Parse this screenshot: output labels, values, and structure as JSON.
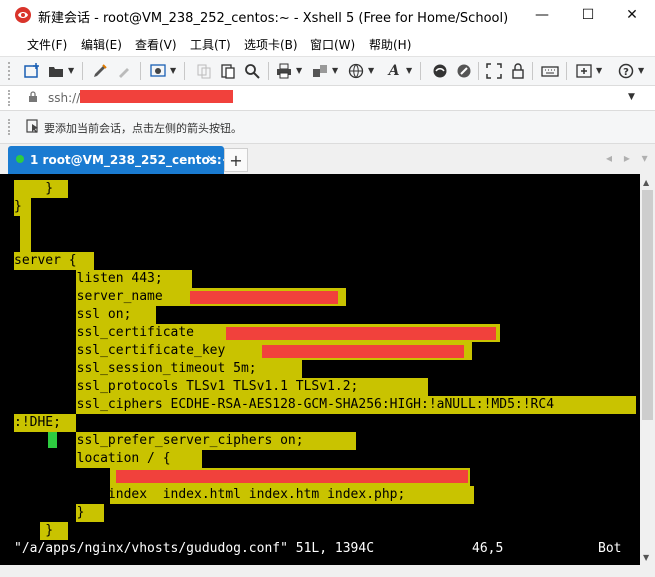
{
  "window": {
    "title": "新建会话 - root@VM_238_252_centos:~ - Xshell 5 (Free for Home/School)",
    "minimize": "—",
    "maximize": "☐",
    "close": "✕"
  },
  "menu": [
    "文件(F)",
    "编辑(E)",
    "查看(V)",
    "工具(T)",
    "选项卡(B)",
    "窗口(W)",
    "帮助(H)"
  ],
  "toolbar_icons": [
    "new-session-icon",
    "open-folder-icon",
    "pen-icon",
    "clear-icon",
    "settings-icon",
    "copy-icon",
    "paste-icon",
    "find-icon",
    "print-icon",
    "transfer-icon",
    "globe-icon",
    "font-icon",
    "xftp-icon",
    "xagent-icon",
    "fullscreen-icon",
    "lock-icon",
    "keyboard-icon",
    "new-tab-icon",
    "help-icon"
  ],
  "address": {
    "text": "ssh://"
  },
  "hint": {
    "text": "要添加当前会话，点击左侧的箭头按钮。"
  },
  "tabs": [
    {
      "label": "1 root@VM_238_252_centos:~",
      "close": "×",
      "status_color": "#2ecc40"
    }
  ],
  "tab_add": "+",
  "tab_nav": "◂ ▸ ▾",
  "terminal": {
    "lines": [
      "    }",
      "}",
      "",
      "",
      "server {",
      "        listen 443;",
      "        server_name ",
      "        ssl on;",
      "        ssl_certificate ",
      "        ssl_certificate_key ",
      "        ssl_session_timeout 5m;",
      "        ssl_protocols TLSv1 TLSv1.1 TLSv1.2;",
      "        ssl_ciphers ECDHE-RSA-AES128-GCM-SHA256:HIGH:!aNULL:!MD5:!RC4",
      ":!DHE;",
      "        ssl_prefer_server_ciphers on;",
      "        location / {",
      "",
      "            index  index.html index.htm index.php;",
      "        }",
      "    }"
    ],
    "status_file": "\"/a/apps/nginx/vhosts/gududog.conf\" 51L, 1394C",
    "status_pos": "46,5",
    "status_scroll": "Bot",
    "highlight_color": "#c9c300",
    "redact_color": "#f1413c"
  }
}
